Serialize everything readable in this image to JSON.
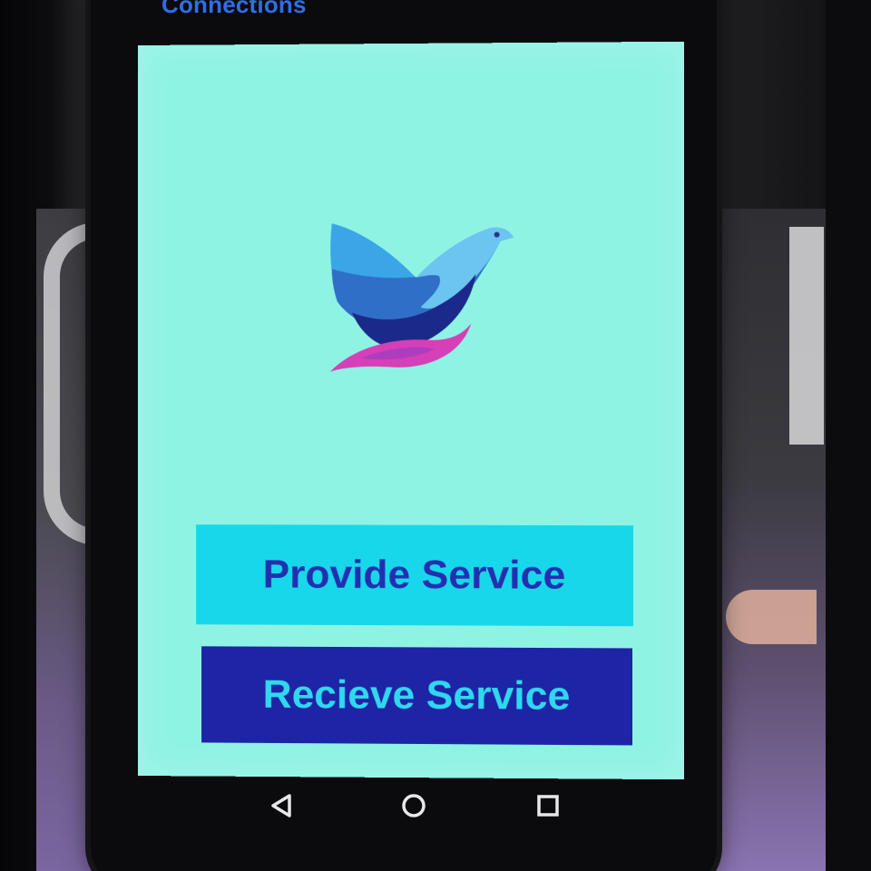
{
  "header": {
    "partial_title": "Connections"
  },
  "app": {
    "logo_icon": "dove-logo-icon",
    "screen_background": "#8ff3e4"
  },
  "buttons": {
    "provide_label": "Provide Service",
    "receive_label": "Recieve Service",
    "provide_bg": "#19d7ea",
    "provide_fg": "#2230b0",
    "receive_bg": "#1e24a6",
    "receive_fg": "#2fd8ee"
  },
  "navbar": {
    "back_icon": "back-triangle-icon",
    "home_icon": "home-circle-icon",
    "recent_icon": "recent-apps-square-icon"
  }
}
